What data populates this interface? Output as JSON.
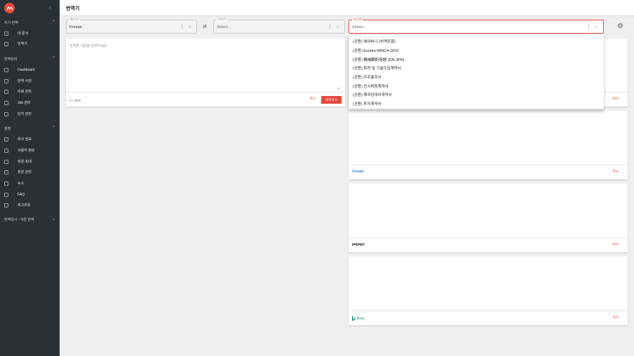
{
  "sidebar": {
    "sections": [
      {
        "label": "자가 번역",
        "items": [
          {
            "label": "내 문서",
            "icon": "file-icon"
          },
          {
            "label": "번역기",
            "icon": "translate-icon"
          }
        ]
      },
      {
        "label": "번역관리",
        "items": [
          {
            "label": "Dashboard",
            "icon": "dashboard-icon"
          },
          {
            "label": "번역 사전",
            "icon": "book-icon"
          },
          {
            "label": "의뢰 관리",
            "icon": "list-icon"
          },
          {
            "label": "Job 관리",
            "icon": "list-icon"
          },
          {
            "label": "단가 관리",
            "icon": "card-icon"
          }
        ]
      },
      {
        "label": "설정",
        "items": [
          {
            "label": "회사 정보",
            "icon": "settings-icon"
          },
          {
            "label": "사용자 정보",
            "icon": "person-icon"
          },
          {
            "label": "회원 초대",
            "icon": "document-icon"
          },
          {
            "label": "회원 관리",
            "icon": "person-icon"
          },
          {
            "label": "뉴스",
            "icon": "news-icon"
          },
          {
            "label": "FAQ",
            "icon": "document-icon"
          },
          {
            "label": "로그아웃",
            "icon": "logout-icon"
          }
        ]
      }
    ],
    "footer_section": "번역회사 - 자존 번역"
  },
  "header": {
    "title": "번역기"
  },
  "source_lang": {
    "label": "원본언어",
    "value": "Korean"
  },
  "target_lang": {
    "label": "번역언어",
    "value": "Select..."
  },
  "dictionary": {
    "label": "사전선택",
    "value": "Select..."
  },
  "input": {
    "placeholder": "번역할 내용을 입력하세요.",
    "counter": "0 / 3000",
    "copy_label": "복사",
    "translate_label": "번역하기"
  },
  "results": [
    {
      "engine": "",
      "copy_label": "복사"
    },
    {
      "engine": "Google",
      "copy_label": "복사"
    },
    {
      "engine": "papago",
      "copy_label": "복사"
    },
    {
      "engine": "Bing",
      "copy_label": "복사"
    }
  ],
  "dropdown_options": [
    "(공용) 헤이버니 (치멕포함)",
    "(공용) Eureka MWCA 2019",
    "(공용) 機械翻訳用語 (EN-JPN)",
    "(공용) 특허 및 기술도입계약서",
    "(공용) 주주총회서",
    "(공용) 컨시퍼럼계약서",
    "(공용) 해외임대차계약서",
    "(공용) 투자계약서"
  ],
  "colors": {
    "accent": "#e8493c",
    "sidebar_bg": "#2b3035"
  }
}
